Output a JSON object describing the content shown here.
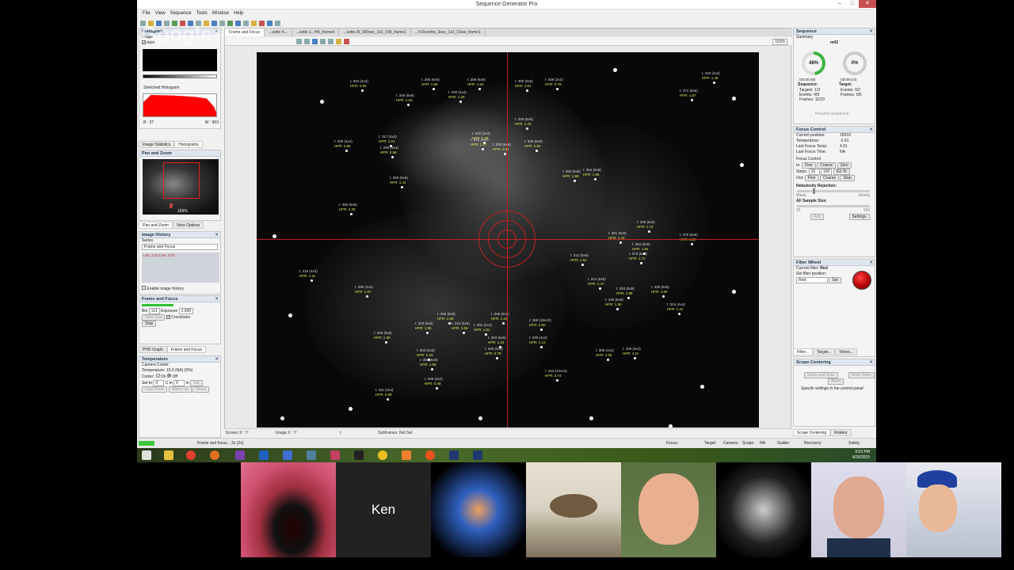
{
  "window": {
    "title": "Sequence Generator Pro",
    "min": "–",
    "max": "□",
    "close": "✕"
  },
  "menu": [
    "File",
    "View",
    "Sequence",
    "Tools",
    "Window",
    "Help"
  ],
  "watermark": "Google+",
  "doc_tabs": [
    "Frame and Focus",
    "...sette 4...",
    "...sette 1...HA_frame4",
    "...sette-3t_300sec_1x1_OIII_frame1",
    "...ft.Rosette_3sec_1x1_Clear_frame1"
  ],
  "zoom": "163%",
  "histogram": {
    "title": "Histogram",
    "image_label": "Image",
    "auto_label": "Auto",
    "stretched_label": "Stretched Histogram",
    "b_val": "B : 37",
    "w_val": "W : 603",
    "auto_checked": true
  },
  "left_tabs": {
    "stats": "Image Statistics",
    "hist": "Histograms"
  },
  "pan_zoom": {
    "title": "Pan and Zoom",
    "zoom": "163%",
    "tab1": "Pan and Zoom",
    "tab2": "View Options"
  },
  "image_history": {
    "title": "Image History",
    "series_label": "Series",
    "series_value": "Frame and Focus",
    "record": "Last: 3.25 Low: 3.20",
    "enable_label": "Enable image history"
  },
  "frame_focus": {
    "title": "Frame and Focus",
    "bin_label": "Bin",
    "bin_value": "1x1",
    "exposure_label": "Exposure",
    "exposure_value": "2.000",
    "take_one": "Take One",
    "crosshairs": "Crosshairs",
    "crosshairs_checked": true,
    "stop": "Stop",
    "tab1": "PHD Graph",
    "tab2": "Frame and Focus"
  },
  "temperature": {
    "title": "Temperature",
    "cooler_label": "Camera Cooler",
    "temp_label": "Temperature: 15.0 (NA) (0%)",
    "cooler": "Cooler:",
    "on": "On",
    "off": "Off",
    "off_checked": true,
    "setto": "Set to",
    "setto_value": "0",
    "cin": "C in",
    "cin_value": "0",
    "unit": "m",
    "set": "Set",
    "cool_down": "Cool Down",
    "warm_up": "Warm Up",
    "reset": "Reset"
  },
  "sequence": {
    "title": "Sequence",
    "summary": "Summary",
    "target": "m42",
    "pct1": "48%",
    "pct2": "0%",
    "time1": "(00:00:48)",
    "time2": "(00:00:24)",
    "seq_label": "Sequence:",
    "tgt_label": "Target:",
    "targets": "Targets: 1/3",
    "events": "Events: 4/9",
    "frames": "Frames: 11/23",
    "t_events": "Events: 0/2",
    "t_frames": "Frames: 0/6",
    "resume": "Resume Sequence"
  },
  "focus_control": {
    "title": "Focus Control",
    "current_position": "Current position:",
    "current_position_value": "25010",
    "temperature": "Temperature:",
    "temperature_value": "-2.61",
    "last_focus_temp": "Last Focus Temp:",
    "last_focus_temp_value": "4.91",
    "last_focus_time": "Last Focus Time:",
    "last_focus_time_value": "NA",
    "focus_control": "Focus Control",
    "in": "In:",
    "out": "Out:",
    "fine": "Fine",
    "coarse": "Coarse",
    "zero": "Zero",
    "steps": "Steps:",
    "steps1": "10",
    "steps2": "100",
    "goto": "Go To",
    "stop": "Stop",
    "nebulosity": "Nebulosity Rejection:",
    "weak": "Weak",
    "strong": "Strong",
    "af_sample": "AF Sample Size:",
    "af_min": "15",
    "af_max": "100",
    "run": "Run",
    "settings": "Settings"
  },
  "filter_wheel": {
    "title": "Filter Wheel",
    "current": "Current filter:",
    "current_value": "Red",
    "set_pos": "Set filter position:",
    "select_value": "Red",
    "set": "Set",
    "tabs": [
      "Filter...",
      "Target...",
      "Telesc..."
    ]
  },
  "scope_centering": {
    "title": "Scope Centering",
    "solve_sync": "Solve and Sync",
    "blind_solve": "Blind Solve",
    "abort": "Abort",
    "note": "Specify settings in the control panel",
    "tab1": "Scope Centering",
    "tab2": "Rotator"
  },
  "coords": {
    "screen": "Screen X : Y:",
    "image": "Image X : Y:",
    "i": "I:",
    "subframe": "Subframes: Not Set"
  },
  "status": {
    "left": "Frame and focus... 2s (2s)",
    "focus": "Focus:",
    "target": "Target:",
    "camera": "Camera:",
    "scope": "Scope:",
    "scope_val": "NA",
    "guider": "Guider:",
    "recovery": "Recovery:",
    "safety": "Safety"
  },
  "clock": {
    "time": "9:53 PM",
    "date": "4/26/2015"
  },
  "participant": "Ken",
  "annotations": [
    {
      "a": "I: 304 (4x4)",
      "h": "HFR: 0.90"
    },
    {
      "a": "I: 265 (6x6)",
      "h": "HFR: 1.80"
    },
    {
      "a": "I: 368 (6x6)",
      "h": "HFR: 1.64"
    },
    {
      "a": "I: 380 (6x6)",
      "h": "HFR: 2.51"
    },
    {
      "a": "I: 308 (2x2)",
      "h": "HFR: 0.78"
    },
    {
      "a": "I: 334 (4x4)",
      "h": "HFR: 1.46"
    },
    {
      "a": "I: 346 (6x6)",
      "h": "HFR: 1.16"
    },
    {
      "a": "I: 330 (4x4)",
      "h": "HFR: 1.26"
    },
    {
      "a": "I: 371 (6x6)",
      "h": "HFR: 1.57"
    },
    {
      "a": "I: 348 (6x6)",
      "h": "HFR: 1.40"
    },
    {
      "a": "I: 300 (4x4)",
      "h": "HFR: 0.85"
    },
    {
      "a": "I: 317 (4x4)",
      "h": "HFR: 1.01"
    },
    {
      "a": "I: 290 (4x4)",
      "h": "HFR: 0.56"
    },
    {
      "a": "I: 330 (4x4)",
      "h": "HFR: 1.26"
    },
    {
      "a": "I: 316 (4x4)",
      "h": "HFR: 1.37"
    },
    {
      "a": "I: 309 (6x6)",
      "h": "HFR: 1.51"
    },
    {
      "a": "I: 306 (6x6)",
      "h": "HFR: 0.84"
    },
    {
      "a": "I: 360 (6x6)",
      "h": "HFR: 1.41"
    },
    {
      "a": "I: 360 (6x6)",
      "h": "HFR: 1.99"
    },
    {
      "a": "I: 364 (6x6)",
      "h": "HFR: 1.66"
    },
    {
      "a": "I: 380 (6x6)",
      "h": "HFR: 2.28"
    },
    {
      "a": "I: 349 (6x6)",
      "h": "HFR: 1.73"
    },
    {
      "a": "I: 301 (6x6)",
      "h": "HFR: 1.18"
    },
    {
      "a": "I: 370 (6x6)",
      "h": "HFR: 1.89"
    },
    {
      "a": "I: 364 (6x6)",
      "h": "HFR: 1.64"
    },
    {
      "a": "I: 312 (6x6)",
      "h": "HFR: 1.52"
    },
    {
      "a": "I: 376 (6x6)",
      "h": "HFR: 1.72"
    },
    {
      "a": "I: 316 (4x4)",
      "h": "HFR: 1.11"
    },
    {
      "a": "I: 295 (4x4)",
      "h": "HFR: 1.07"
    },
    {
      "a": "I: 314 (6x6)",
      "h": "HFR: 1.47"
    },
    {
      "a": "I: 353 (6x6)",
      "h": "HFR: 1.85"
    },
    {
      "a": "I: 340 (6x6)",
      "h": "HFR: 1.60"
    },
    {
      "a": "I: 336 (6x6)",
      "h": "HFR: 1.50"
    },
    {
      "a": "I: 324 (4x4)",
      "h": "HFR: 1.41"
    },
    {
      "a": "I: 265 (6x6)",
      "h": "HFR: 1.29"
    },
    {
      "a": "I: 286 (6x6)",
      "h": "HFR: 1.23"
    },
    {
      "a": "I: 333 (6x6)",
      "h": "HFR: 1.95"
    },
    {
      "a": "I: 310 (6x6)",
      "h": "HFR: 1.66"
    },
    {
      "a": "I: 291 (4x4)",
      "h": "HFR: 1.51"
    },
    {
      "a": "I: 360 (10x10)",
      "h": "HFR: 2.60"
    },
    {
      "a": "I: 280 (6x6)",
      "h": "HFR: 1.39"
    },
    {
      "a": "I: 303 (6x6)",
      "h": "HFR: 1.24"
    },
    {
      "a": "I: 280 (4x4)",
      "h": "HFR: 0.78"
    },
    {
      "a": "I: 290 (4x4)",
      "h": "HFR: 1.12"
    },
    {
      "a": "I: 353 (6x6)",
      "h": "HFR: 2.15"
    },
    {
      "a": "I: 350 (6x6)",
      "h": "HFR: 1.59"
    },
    {
      "a": "I: 369 (4x4)",
      "h": "HFR: 1.05"
    },
    {
      "a": "I: 326 (4x4)",
      "h": "HFR: 1.11"
    },
    {
      "a": "I: 344 (12x12)",
      "h": "HFR: 3.74"
    },
    {
      "a": "I: 286 (2x2)",
      "h": "HFR: 0.48"
    },
    {
      "a": "I: 311 (4x4)",
      "h": "HFR: 0.89"
    }
  ]
}
